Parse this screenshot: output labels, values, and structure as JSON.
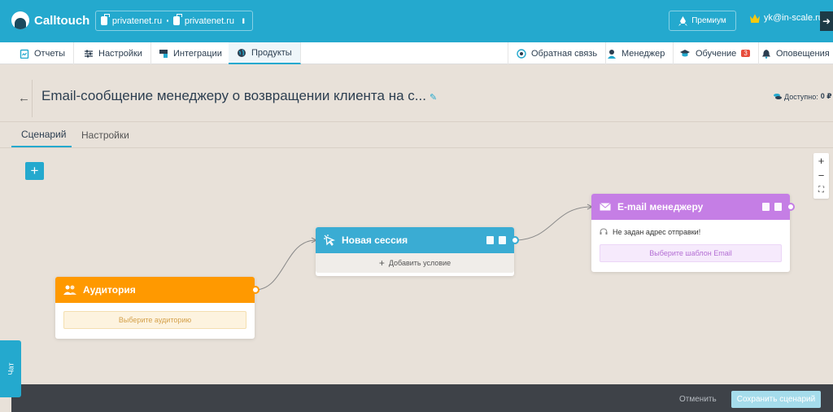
{
  "app": {
    "name": "Calltouch"
  },
  "topbar": {
    "project_a": "privatenet.ru",
    "project_b": "privatenet.ru",
    "premium_label": "Премиум",
    "user_email": "yk@in-scale.ru"
  },
  "nav": {
    "left": [
      {
        "label": "Отчеты",
        "icon": "report-icon"
      },
      {
        "label": "Настройки",
        "icon": "sliders-icon"
      },
      {
        "label": "Интеграции",
        "icon": "puzzle-icon"
      },
      {
        "label": "Продукты",
        "icon": "globe-icon"
      }
    ],
    "right": [
      {
        "label": "Обратная связь",
        "icon": "feedback-icon"
      },
      {
        "label": "Менеджер",
        "icon": "manager-icon"
      },
      {
        "label": "Обучение",
        "icon": "graduation-cap-icon",
        "badge": "3"
      },
      {
        "label": "Оповещения",
        "icon": "bell-icon"
      }
    ]
  },
  "page": {
    "title": "Email-сообщение менеджеру о возвращении клиента на с...",
    "available_label": "Доступно:",
    "available_value": "0 ₽"
  },
  "tabs": [
    "Сценарий",
    "Настройки"
  ],
  "nodes": {
    "audience": {
      "title": "Аудитория",
      "field": "Выберите аудиторию",
      "color": "#ff9900"
    },
    "session": {
      "title": "Новая сессия",
      "add_condition": "Добавить условие",
      "color": "#3aacd3"
    },
    "email": {
      "title": "E-mail менеджеру",
      "warning": "Не задан адрес отправки!",
      "template_btn": "Выберите шаблон Email",
      "color": "#c57ee5"
    }
  },
  "zoom": {
    "plus": "+",
    "minus": "−",
    "fit": "⛶"
  },
  "footer": {
    "cancel": "Отменить",
    "save": "Сохранить сценарий"
  },
  "chat": {
    "label": "Чат"
  }
}
